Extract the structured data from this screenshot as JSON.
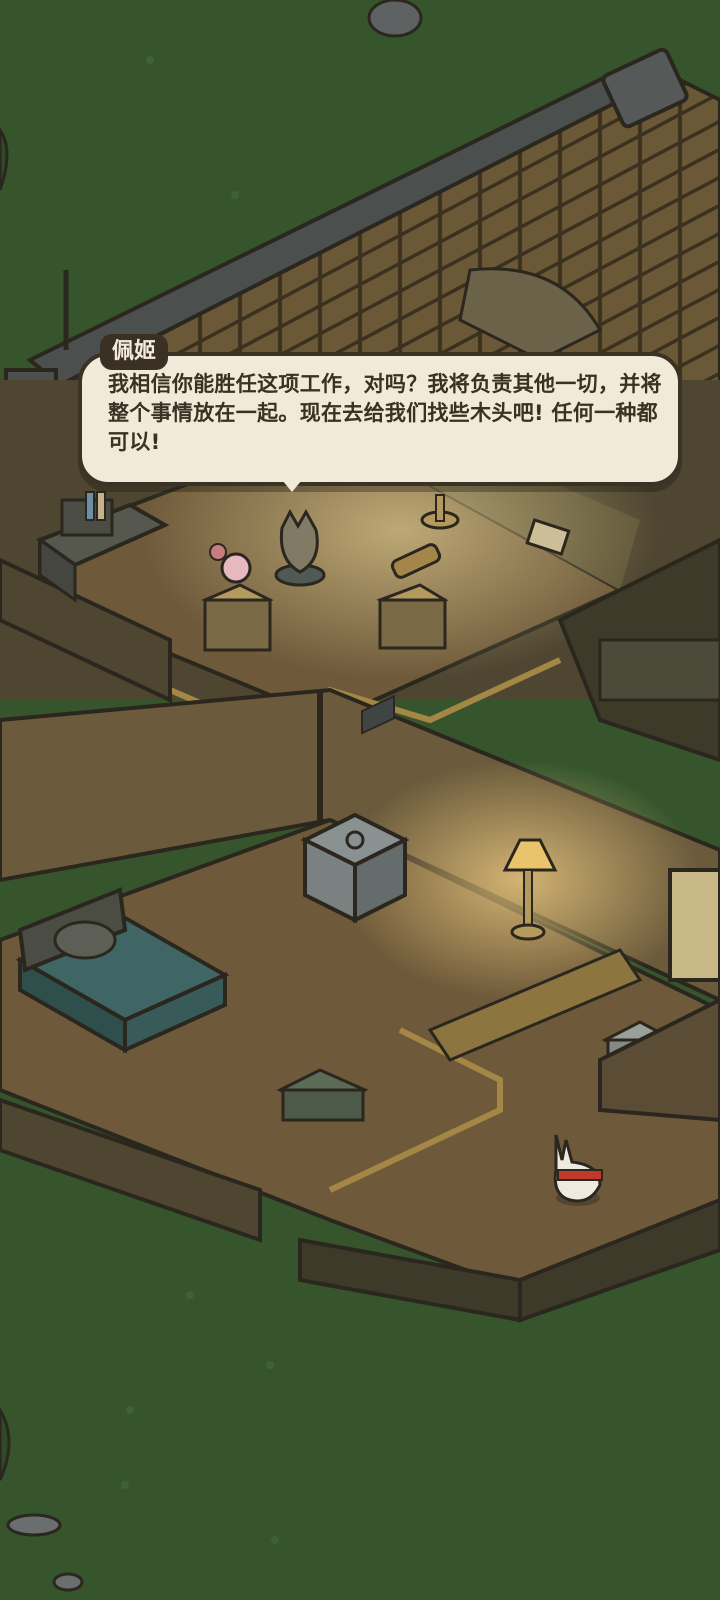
{
  "dialog": {
    "speaker": "佩姬",
    "text": "我相信你能胜任这项工作，对吗？我将负责其他一切，并将整个事情放在一起。现在去给我们找些木头吧! 任何一种都可以!"
  },
  "colors": {
    "grass": "#36552d",
    "wood_floor": "#6e5a3a",
    "wall": "#5b5238",
    "roof": "#6b5836",
    "outline": "#2b271e",
    "lamp_glow": "#ffd98a",
    "bed_sheet": "#3f6664",
    "dialog_bg": "#f1ead8",
    "name_tag_bg": "#3a3024"
  }
}
